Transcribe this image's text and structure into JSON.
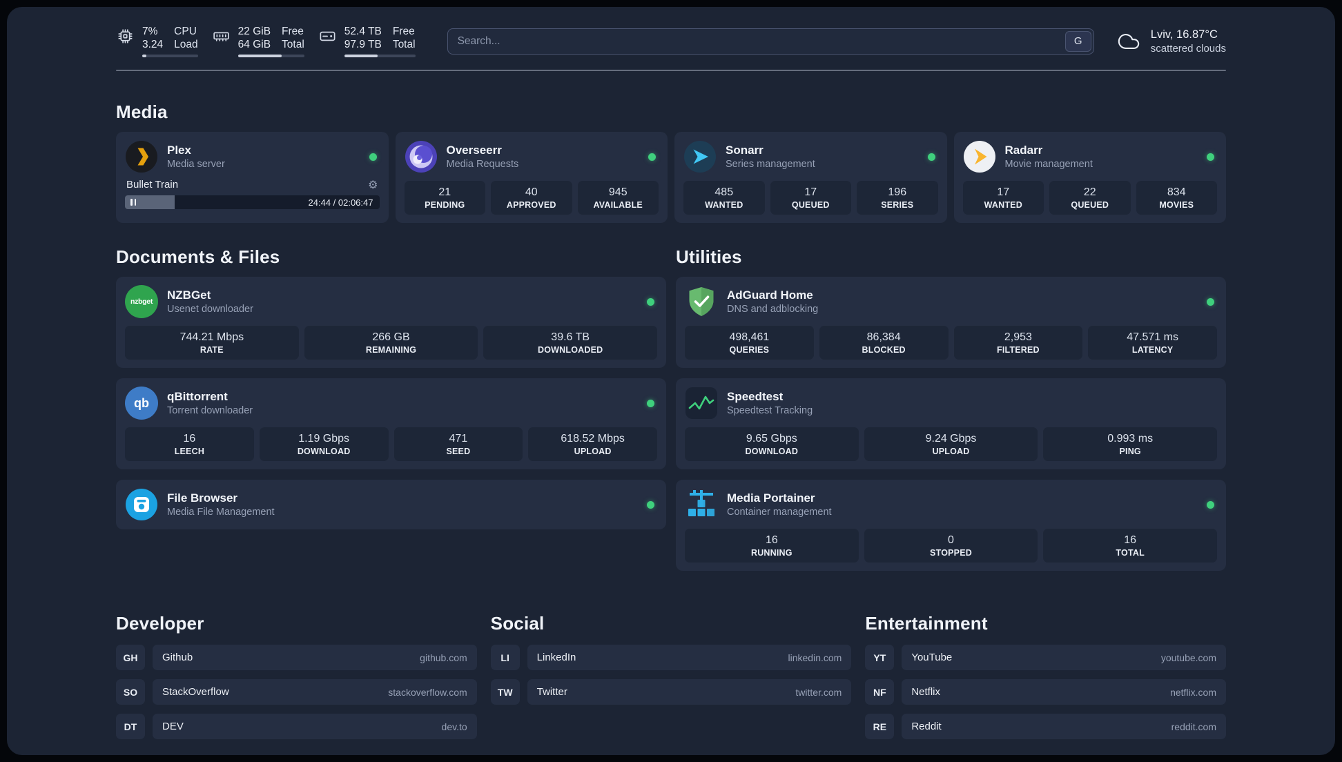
{
  "icons": {
    "gear": "⚙"
  },
  "topbar": {
    "cpu": {
      "value": "7%",
      "load": "3.24",
      "label1": "CPU",
      "label2": "Load",
      "bar": "7%"
    },
    "memory": {
      "free": "22 GiB",
      "total": "64 GiB",
      "label1": "Free",
      "label2": "Total",
      "bar": "66%"
    },
    "disk": {
      "free": "52.4 TB",
      "total": "97.9 TB",
      "label1": "Free",
      "label2": "Total",
      "bar": "47%"
    },
    "search": {
      "placeholder": "Search...",
      "button": "G"
    },
    "weather": {
      "location": "Lviv, 16.87°C",
      "condition": "scattered clouds"
    }
  },
  "media": {
    "title": "Media",
    "plex": {
      "name": "Plex",
      "desc": "Media server",
      "now_playing": "Bullet Train",
      "time": "24:44 / 02:06:47",
      "progress": "19.5%"
    },
    "overseerr": {
      "name": "Overseerr",
      "desc": "Media Requests",
      "stats": [
        {
          "value": "21",
          "label": "PENDING"
        },
        {
          "value": "40",
          "label": "APPROVED"
        },
        {
          "value": "945",
          "label": "AVAILABLE"
        }
      ]
    },
    "sonarr": {
      "name": "Sonarr",
      "desc": "Series management",
      "stats": [
        {
          "value": "485",
          "label": "WANTED"
        },
        {
          "value": "17",
          "label": "QUEUED"
        },
        {
          "value": "196",
          "label": "SERIES"
        }
      ]
    },
    "radarr": {
      "name": "Radarr",
      "desc": "Movie management",
      "stats": [
        {
          "value": "17",
          "label": "WANTED"
        },
        {
          "value": "22",
          "label": "QUEUED"
        },
        {
          "value": "834",
          "label": "MOVIES"
        }
      ]
    }
  },
  "documents": {
    "title": "Documents & Files",
    "nzbget": {
      "name": "NZBGet",
      "desc": "Usenet downloader",
      "icon_text": "nzbget",
      "stats": [
        {
          "value": "744.21 Mbps",
          "label": "RATE"
        },
        {
          "value": "266 GB",
          "label": "REMAINING"
        },
        {
          "value": "39.6 TB",
          "label": "DOWNLOADED"
        }
      ]
    },
    "qbittorrent": {
      "name": "qBittorrent",
      "desc": "Torrent downloader",
      "icon_text": "qb",
      "stats": [
        {
          "value": "16",
          "label": "LEECH"
        },
        {
          "value": "1.19 Gbps",
          "label": "DOWNLOAD"
        },
        {
          "value": "471",
          "label": "SEED"
        },
        {
          "value": "618.52 Mbps",
          "label": "UPLOAD"
        }
      ]
    },
    "filebrowser": {
      "name": "File Browser",
      "desc": "Media File Management"
    }
  },
  "utilities": {
    "title": "Utilities",
    "adguard": {
      "name": "AdGuard Home",
      "desc": "DNS and adblocking",
      "stats": [
        {
          "value": "498,461",
          "label": "QUERIES"
        },
        {
          "value": "86,384",
          "label": "BLOCKED"
        },
        {
          "value": "2,953",
          "label": "FILTERED"
        },
        {
          "value": "47.571 ms",
          "label": "LATENCY"
        }
      ]
    },
    "speedtest": {
      "name": "Speedtest",
      "desc": "Speedtest Tracking",
      "stats": [
        {
          "value": "9.65 Gbps",
          "label": "DOWNLOAD"
        },
        {
          "value": "9.24 Gbps",
          "label": "UPLOAD"
        },
        {
          "value": "0.993 ms",
          "label": "PING"
        }
      ]
    },
    "portainer": {
      "name": "Media Portainer",
      "desc": "Container management",
      "stats": [
        {
          "value": "16",
          "label": "RUNNING"
        },
        {
          "value": "0",
          "label": "STOPPED"
        },
        {
          "value": "16",
          "label": "TOTAL"
        }
      ]
    }
  },
  "bookmarks": {
    "developer": {
      "title": "Developer",
      "items": [
        {
          "abbr": "GH",
          "name": "Github",
          "domain": "github.com"
        },
        {
          "abbr": "SO",
          "name": "StackOverflow",
          "domain": "stackoverflow.com"
        },
        {
          "abbr": "DT",
          "name": "DEV",
          "domain": "dev.to"
        }
      ]
    },
    "social": {
      "title": "Social",
      "items": [
        {
          "abbr": "LI",
          "name": "LinkedIn",
          "domain": "linkedin.com"
        },
        {
          "abbr": "TW",
          "name": "Twitter",
          "domain": "twitter.com"
        }
      ]
    },
    "entertainment": {
      "title": "Entertainment",
      "items": [
        {
          "abbr": "YT",
          "name": "YouTube",
          "domain": "youtube.com"
        },
        {
          "abbr": "NF",
          "name": "Netflix",
          "domain": "netflix.com"
        },
        {
          "abbr": "RE",
          "name": "Reddit",
          "domain": "reddit.com"
        }
      ]
    }
  }
}
